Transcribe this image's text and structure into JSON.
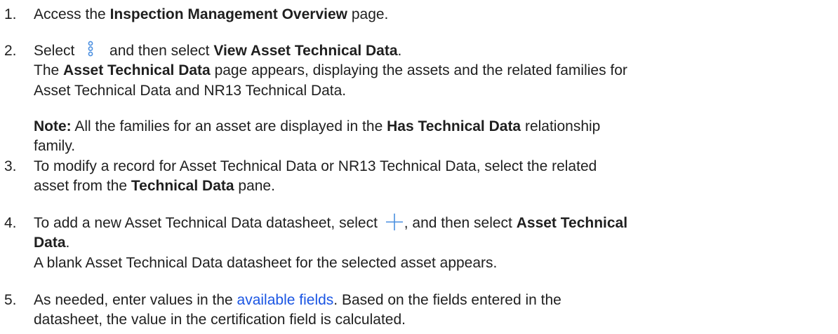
{
  "icons": {
    "options_menu": "vertical-ellipsis-icon",
    "add": "plus-icon",
    "accent_color": "#1a73e8",
    "link_color": "#1a55e3"
  },
  "steps": [
    {
      "number": "1.",
      "t1": "Access the ",
      "b1": "Inspection Management Overview",
      "t2": " page."
    },
    {
      "number": "2.",
      "t1": "Select ",
      "t2": " and then select ",
      "b1": "View Asset Technical Data",
      "t3": ".",
      "r1_b1": "Asset Technical Data",
      "r1_t1": " page appears, displaying the assets and the related families for",
      "r1_t0": "The ",
      "r2": "Asset Technical Data and NR13 Technical Data.",
      "note_label": "Note:",
      "note_t1": " All the families for an asset are displayed in the ",
      "note_b1": "Has Technical Data",
      "note_t2": " relationship",
      "note_r2": "family."
    },
    {
      "number": "3.",
      "t1": "To modify a record for Asset Technical Data or NR13 Technical Data, select the related",
      "r1_t1": "asset from the ",
      "r1_b1": "Technical Data",
      "r1_t2": " pane."
    },
    {
      "number": "4.",
      "t1": "To add a new Asset Technical Data datasheet, select ",
      "t2": ", and then select ",
      "b1": "Asset Technical",
      "r1_b1": "Data",
      "r1_t1": ".",
      "r2": "A blank Asset Technical Data datasheet for the selected asset appears."
    },
    {
      "number": "5.",
      "t1": "As needed, enter values in the ",
      "link": "available fields",
      "t2": ". Based on the fields entered in the",
      "r1": "datasheet, the value in the certification field is calculated."
    }
  ]
}
